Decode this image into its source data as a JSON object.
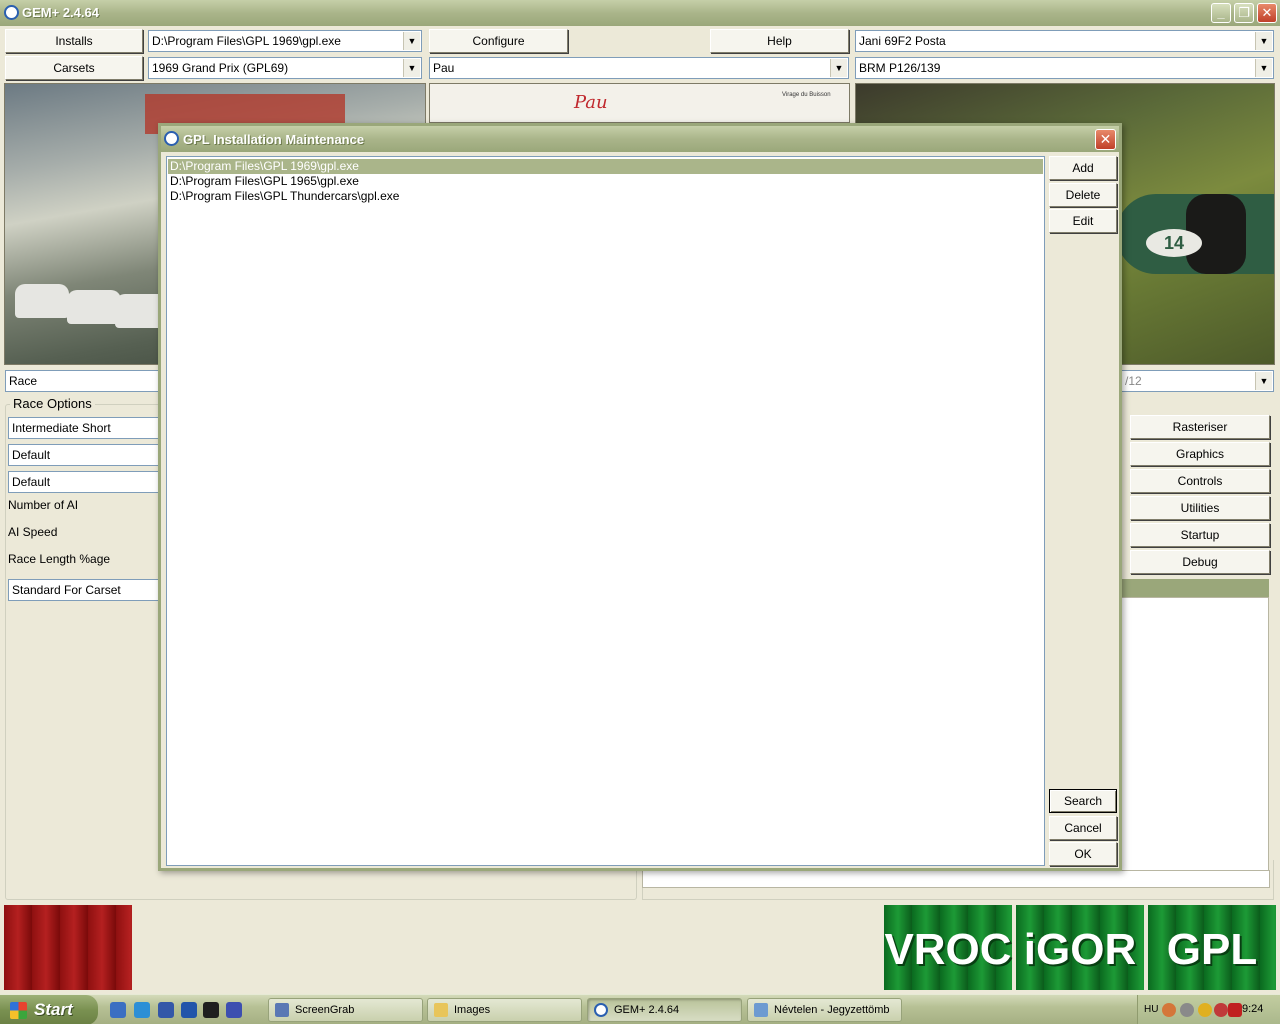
{
  "app": {
    "title": "GEM+ 2.4.64",
    "window_controls": {
      "minimize": "_",
      "restore": "❐",
      "close": "✕"
    }
  },
  "toolbar": {
    "installs_label": "Installs",
    "carsets_label": "Carsets",
    "configure_label": "Configure",
    "help_label": "Help",
    "install_path": "D:\\Program Files\\GPL 1969\\gpl.exe",
    "carset": "1969 Grand Prix (GPL69)",
    "track": "Pau",
    "driver": "Jani 69F2 Posta",
    "car": "BRM P126/139",
    "dropdown_glyph": "▼"
  },
  "photos": {
    "mid_track_name": "Pau",
    "mid_corner": "Virage du Buisson",
    "right_car_number": "14"
  },
  "race": {
    "session": "Race",
    "options_title": "Race Options",
    "option1": "Intermediate Short",
    "option2": "Default",
    "option3": "Default",
    "number_of_ai_label": "Number of AI",
    "ai_speed_label": "AI Speed",
    "race_length_label": "Race Length %age",
    "race_length_value": "Standard For Carset",
    "right_combo_value": "/12"
  },
  "right_buttons": [
    "Rasteriser",
    "Graphics",
    "Controls",
    "Utilities",
    "Startup",
    "Debug"
  ],
  "banners": {
    "vroc": "VROC",
    "igor": "iGOR",
    "gpl": "GPL"
  },
  "dialog": {
    "title": "GPL Installation Maintenance",
    "close": "✕",
    "installs": [
      "D:\\Program Files\\GPL 1969\\gpl.exe",
      "D:\\Program Files\\GPL 1965\\gpl.exe",
      "D:\\Program Files\\GPL Thundercars\\gpl.exe"
    ],
    "selected_index": 0,
    "add_label": "Add",
    "delete_label": "Delete",
    "edit_label": "Edit",
    "search_label": "Search",
    "cancel_label": "Cancel",
    "ok_label": "OK"
  },
  "taskbar": {
    "start_label": "Start",
    "tasks": [
      "ScreenGrab",
      "Images",
      "GEM+ 2.4.64",
      "Névtelen - Jegyzettömb"
    ],
    "active_task": 2,
    "language": "HU",
    "clock": "9:24"
  },
  "colors": {
    "title_bar": "#aab58a",
    "selection": "#aab58a",
    "banner_green": "#1d9a36",
    "banner_red": "#b42020"
  }
}
